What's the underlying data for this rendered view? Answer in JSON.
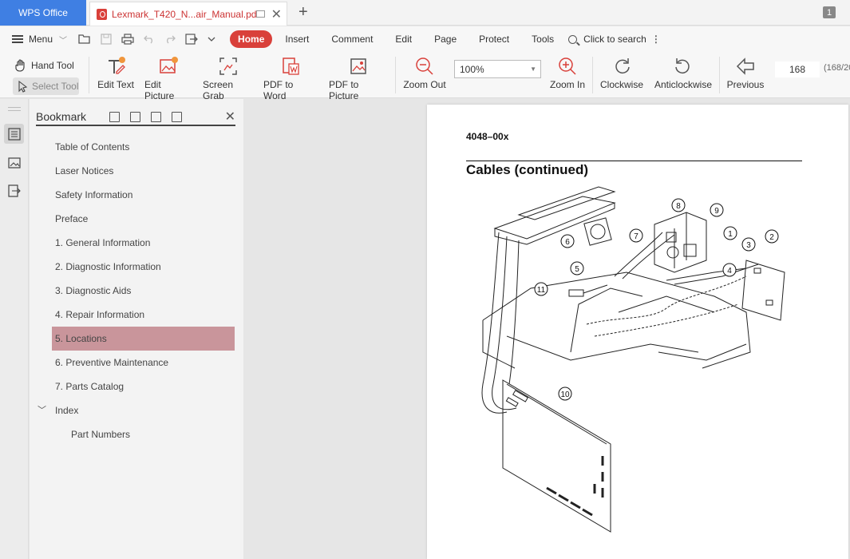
{
  "titlebar": {
    "app_name": "WPS Office",
    "doc_tab": "Lexmark_T420_N...air_Manual.pdf",
    "page_badge": "1"
  },
  "menubar": {
    "menu_label": "Menu",
    "tabs": [
      "Home",
      "Insert",
      "Comment",
      "Edit",
      "Page",
      "Protect",
      "Tools"
    ],
    "search_label": "Click to search"
  },
  "toolbar": {
    "hand_tool": "Hand Tool",
    "select_tool": "Select Tool",
    "buttons": {
      "edit_text": "Edit Text",
      "edit_picture": "Edit Picture",
      "screen_grab": "Screen Grab",
      "pdf_to_word": "PDF to Word",
      "pdf_to_picture": "PDF to Picture",
      "zoom_out": "Zoom Out",
      "zoom_in": "Zoom In",
      "clockwise": "Clockwise",
      "anticlockwise": "Anticlockwise",
      "previous": "Previous"
    },
    "zoom_value": "100%",
    "page_number": "168",
    "page_total": "(168/20"
  },
  "bookmark": {
    "title": "Bookmark",
    "items": [
      "Table of Contents",
      "Laser Notices",
      "Safety Information",
      "Preface",
      "1. General Information",
      "2. Diagnostic Information",
      "3. Diagnostic Aids",
      "4. Repair Information",
      "5. Locations",
      "6. Preventive Maintenance",
      "7. Parts Catalog",
      "Index",
      "Part Numbers"
    ]
  },
  "document": {
    "code": "4048–00x",
    "heading": "Cables (continued)",
    "callouts": [
      "1",
      "2",
      "3",
      "4",
      "5",
      "6",
      "7",
      "8",
      "9",
      "10",
      "11"
    ]
  },
  "colors": {
    "accent": "#d9403a",
    "app_tab": "#3f7fe3",
    "selected_bookmark": "#c9959b"
  }
}
